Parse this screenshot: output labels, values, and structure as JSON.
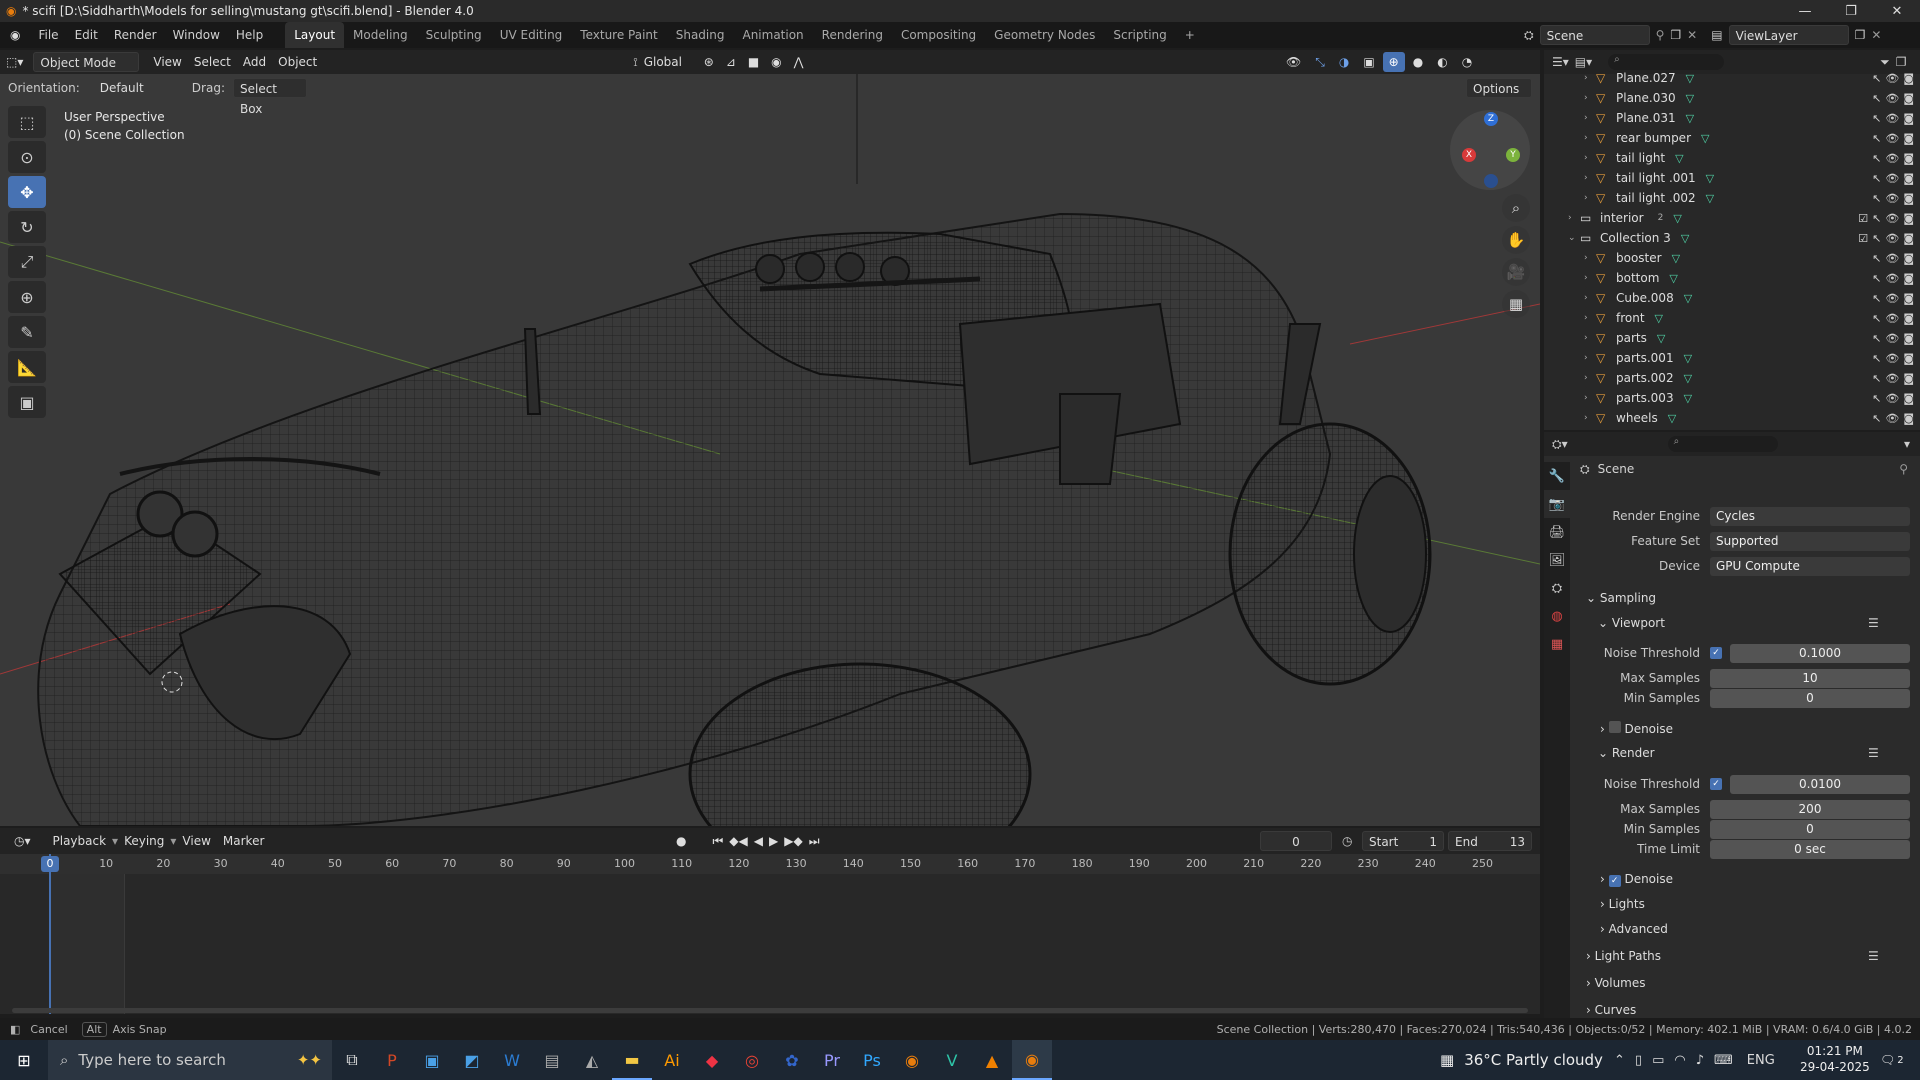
{
  "window": {
    "title": "* scifi [D:\\Siddharth\\Models for selling\\mustang gt\\scifi.blend] - Blender 4.0"
  },
  "menu": [
    "File",
    "Edit",
    "Render",
    "Window",
    "Help"
  ],
  "workspaces": [
    "Layout",
    "Modeling",
    "Sculpting",
    "UV Editing",
    "Texture Paint",
    "Shading",
    "Animation",
    "Rendering",
    "Compositing",
    "Geometry Nodes",
    "Scripting"
  ],
  "active_workspace": "Layout",
  "scene": {
    "label": "Scene",
    "view_layer": "ViewLayer"
  },
  "viewport_header": {
    "mode": "Object Mode",
    "menus": [
      "View",
      "Select",
      "Add",
      "Object"
    ],
    "transform": "Global",
    "orientation_label": "Orientation:",
    "orientation_value": "Default",
    "drag_label": "Drag:",
    "drag_value": "Select Box",
    "options": "Options"
  },
  "viewport": {
    "perspective": "User Perspective",
    "collection": "(0) Scene Collection",
    "gizmo": {
      "x": "X",
      "y": "Y",
      "z": "Z"
    }
  },
  "outliner": {
    "rows": [
      {
        "name": "Plane.027",
        "indent": 2
      },
      {
        "name": "Plane.030",
        "indent": 2
      },
      {
        "name": "Plane.031",
        "indent": 2
      },
      {
        "name": "rear bumper",
        "indent": 2
      },
      {
        "name": "tail light",
        "indent": 2
      },
      {
        "name": "tail light .001",
        "indent": 2
      },
      {
        "name": "tail light .002",
        "indent": 2
      },
      {
        "name": "interior",
        "indent": 1,
        "badge": "2"
      },
      {
        "name": "Collection 3",
        "indent": 1
      },
      {
        "name": "booster",
        "indent": 2
      },
      {
        "name": "bottom",
        "indent": 2
      },
      {
        "name": "Cube.008",
        "indent": 2
      },
      {
        "name": "front",
        "indent": 2
      },
      {
        "name": "parts",
        "indent": 2
      },
      {
        "name": "parts.001",
        "indent": 2
      },
      {
        "name": "parts.002",
        "indent": 2
      },
      {
        "name": "parts.003",
        "indent": 2
      },
      {
        "name": "wheels",
        "indent": 2
      }
    ]
  },
  "properties": {
    "context": "Scene",
    "render_engine_label": "Render Engine",
    "render_engine": "Cycles",
    "feature_set_label": "Feature Set",
    "feature_set": "Supported",
    "device_label": "Device",
    "device": "GPU Compute",
    "sampling": "Sampling",
    "viewport_section": "Viewport",
    "render_section": "Render",
    "noise_threshold_label": "Noise Threshold",
    "max_samples_label": "Max Samples",
    "min_samples_label": "Min Samples",
    "time_limit_label": "Time Limit",
    "viewport_noise_threshold": "0.1000",
    "viewport_max_samples": "10",
    "viewport_min_samples": "0",
    "render_noise_threshold": "0.0100",
    "render_max_samples": "200",
    "render_min_samples": "0",
    "render_time_limit": "0 sec",
    "denoise": "Denoise",
    "lights": "Lights",
    "advanced": "Advanced",
    "light_paths": "Light Paths",
    "volumes": "Volumes",
    "curves": "Curves"
  },
  "timeline": {
    "menus": [
      "Playback",
      "Keying",
      "View",
      "Marker"
    ],
    "current_frame": "0",
    "start_label": "Start",
    "start": "1",
    "end_label": "End",
    "end": "13",
    "ticks": [
      "0",
      "10",
      "20",
      "30",
      "40",
      "50",
      "60",
      "70",
      "80",
      "90",
      "100",
      "110",
      "120",
      "130",
      "140",
      "150",
      "160",
      "170",
      "180",
      "190",
      "200",
      "210",
      "220",
      "230",
      "240",
      "250"
    ]
  },
  "statusbar": {
    "cancel": "Cancel",
    "alt": "Alt",
    "axis_snap": "Axis Snap",
    "stats": "Scene Collection | Verts:280,470 | Faces:270,024 | Tris:540,436 | Objects:0/52 | Memory: 402.1 MiB | VRAM: 0.6/4.0 GiB | 4.0.2"
  },
  "taskbar": {
    "search_placeholder": "Type here to search",
    "weather": "36°C  Partly cloudy",
    "lang": "ENG",
    "time": "01:21 PM",
    "date": "29-04-2025",
    "notif": "2"
  },
  "colors": {
    "accent": "#4772b3",
    "mesh_wire": "#1a1a1a",
    "axis_x": "#b03a3a",
    "axis_y": "#7a9a3a"
  }
}
